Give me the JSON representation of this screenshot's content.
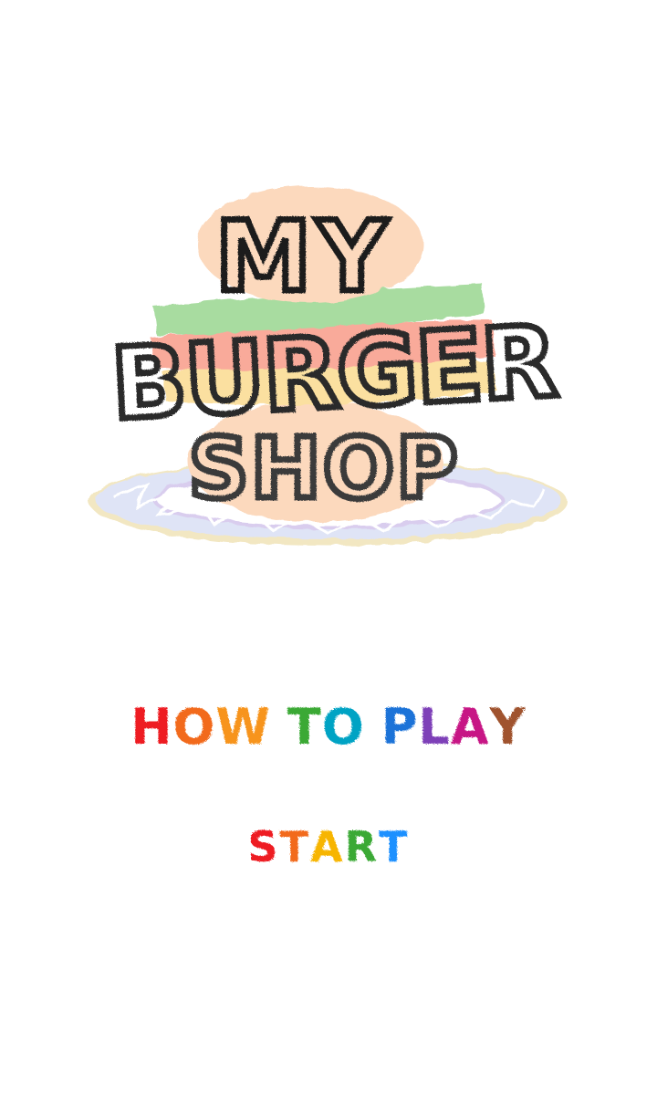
{
  "logo": {
    "line1": "MY",
    "line2": "BURGER",
    "line3": "SHOP",
    "colors": {
      "bun": "#fcd9bd",
      "lettuce": "#a8dca0",
      "tomato": "#f9aa9a",
      "cheese": "#fbe0a0",
      "plate": "#dfe4f6",
      "plate_rim": "#f2e7c2",
      "ink": "#1c1c1c"
    }
  },
  "menu": {
    "how_to_play": {
      "label": "HOW TO PLAY",
      "letter_colors": [
        "#ee1c24",
        "#f26a1b",
        "#f7941d",
        "#3aa935",
        "#00a3c4",
        "#1e73d8",
        "#7e3fb8",
        "#c71585",
        "#a0522d"
      ]
    },
    "start": {
      "label": "START",
      "letter_colors": [
        "#ee1c24",
        "#f26a1b",
        "#f7b500",
        "#3aa935",
        "#1e90ff"
      ]
    }
  }
}
